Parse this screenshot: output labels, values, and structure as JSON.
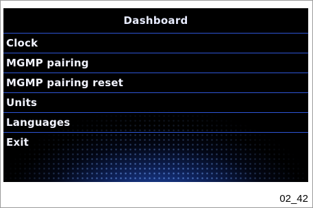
{
  "screen": {
    "title": "Dashboard",
    "menu": [
      {
        "label": "Clock"
      },
      {
        "label": "MGMP pairing"
      },
      {
        "label": "MGMP pairing reset"
      },
      {
        "label": "Units"
      },
      {
        "label": "Languages"
      },
      {
        "label": "Exit"
      }
    ]
  },
  "figure_label": "02_42",
  "colors": {
    "background": "#000000",
    "accent_line": "#2e56d8",
    "text": "#f2f4ff"
  }
}
